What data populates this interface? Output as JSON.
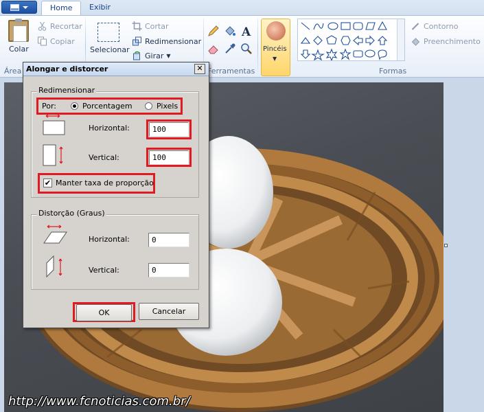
{
  "ribbon": {
    "tabs": [
      {
        "label": "Home"
      },
      {
        "label": "Exibir"
      }
    ],
    "clipboard": {
      "paste": "Colar",
      "cut": "Recortar",
      "copy": "Copiar",
      "group_label": "Área"
    },
    "image": {
      "select": "Selecionar",
      "crop": "Cortar",
      "resize": "Redimensionar",
      "rotate": "Girar"
    },
    "tools": {
      "group_label": "Ferramentas",
      "icons": [
        "pencil-icon",
        "fill-icon",
        "text-icon",
        "eraser-icon",
        "color-picker-icon",
        "magnifier-icon"
      ]
    },
    "brushes": {
      "label": "Pincéis"
    },
    "shapes": {
      "group_label": "Formas",
      "outline": "Contorno",
      "fill": "Preenchimento"
    }
  },
  "dialog": {
    "title": "Alongar e distorcer",
    "resize_section": {
      "legend": "Redimensionar",
      "by_label": "Por:",
      "options": [
        {
          "label": "Porcentagem",
          "selected": true
        },
        {
          "label": "Pixels",
          "selected": false
        }
      ],
      "horizontal_label": "Horizontal:",
      "horizontal_value": "100",
      "vertical_label": "Vertical:",
      "vertical_value": "100",
      "keep_ratio_label": "Manter taxa de proporção",
      "keep_ratio_checked": true
    },
    "skew_section": {
      "legend": "Distorção (Graus)",
      "horizontal_label": "Horizontal:",
      "horizontal_value": "0",
      "vertical_label": "Vertical:",
      "vertical_value": "0"
    },
    "ok_label": "OK",
    "cancel_label": "Cancelar"
  },
  "watermark": "http://www.fcnoticias.com.br/",
  "colors": {
    "highlight": "#e01a22",
    "ribbon_text": "#15428b",
    "dialog_bg": "#d6d3ce"
  }
}
